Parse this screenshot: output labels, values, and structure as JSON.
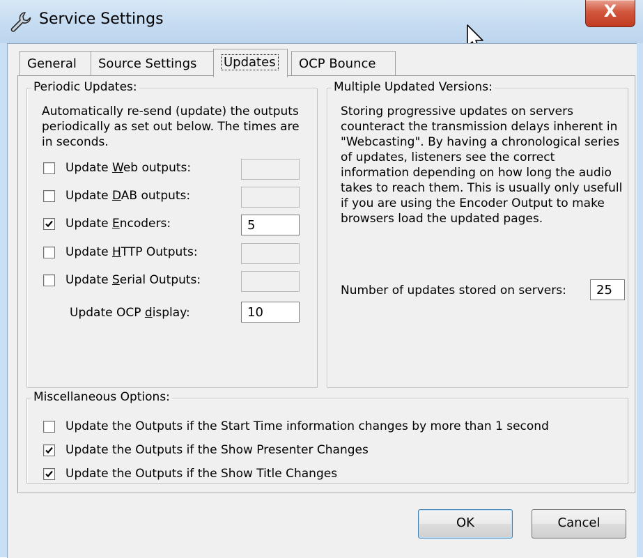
{
  "window": {
    "title": "Service Settings",
    "close_glyph": "X",
    "icon": "wrench-icon"
  },
  "tabs": [
    {
      "label": "General",
      "active": false
    },
    {
      "label": "Source Settings",
      "active": false
    },
    {
      "label": "Updates",
      "active": true
    },
    {
      "label": "OCP Bounce",
      "active": false
    }
  ],
  "periodic": {
    "title": "Periodic Updates:",
    "desc": "Automatically re-send (update) the outputs periodically as set out below. The times are in seconds.",
    "items": [
      {
        "pre": "Update ",
        "key": "W",
        "post": "eb outputs:",
        "checked": false,
        "value": "",
        "enabled": false
      },
      {
        "pre": "Update ",
        "key": "D",
        "post": "AB outputs:",
        "checked": false,
        "value": "",
        "enabled": false
      },
      {
        "pre": "Update ",
        "key": "E",
        "post": "ncoders:",
        "checked": true,
        "value": "5",
        "enabled": true
      },
      {
        "pre": "Update ",
        "key": "H",
        "post": "TTP Outputs:",
        "checked": false,
        "value": "",
        "enabled": false
      },
      {
        "pre": "Update ",
        "key": "S",
        "post": "erial Outputs:",
        "checked": false,
        "value": "",
        "enabled": false
      }
    ],
    "ocp": {
      "pre": "Update OCP ",
      "key": "d",
      "post": "isplay:",
      "value": "10"
    }
  },
  "multiple": {
    "title": "Multiple Updated Versions:",
    "desc": "Storing progressive updates on servers counteract the transmission delays inherent in \"Webcasting\". By having a chronological series of updates, listeners see the correct information depending on how long the audio takes to reach them. This is usually only usefull if you are using the Encoder Output to make browsers load the updated pages.",
    "count_label": "Number of updates stored on servers:",
    "count_value": "25"
  },
  "misc": {
    "title": "Miscellaneous Options:",
    "options": [
      {
        "label": "Update the Outputs if the Start Time information changes by more than 1 second",
        "checked": false
      },
      {
        "label": "Update the Outputs if the Show Presenter Changes",
        "checked": true
      },
      {
        "label": "Update the Outputs if the Show Title Changes",
        "checked": true
      }
    ]
  },
  "buttons": {
    "ok": "OK",
    "cancel": "Cancel"
  }
}
